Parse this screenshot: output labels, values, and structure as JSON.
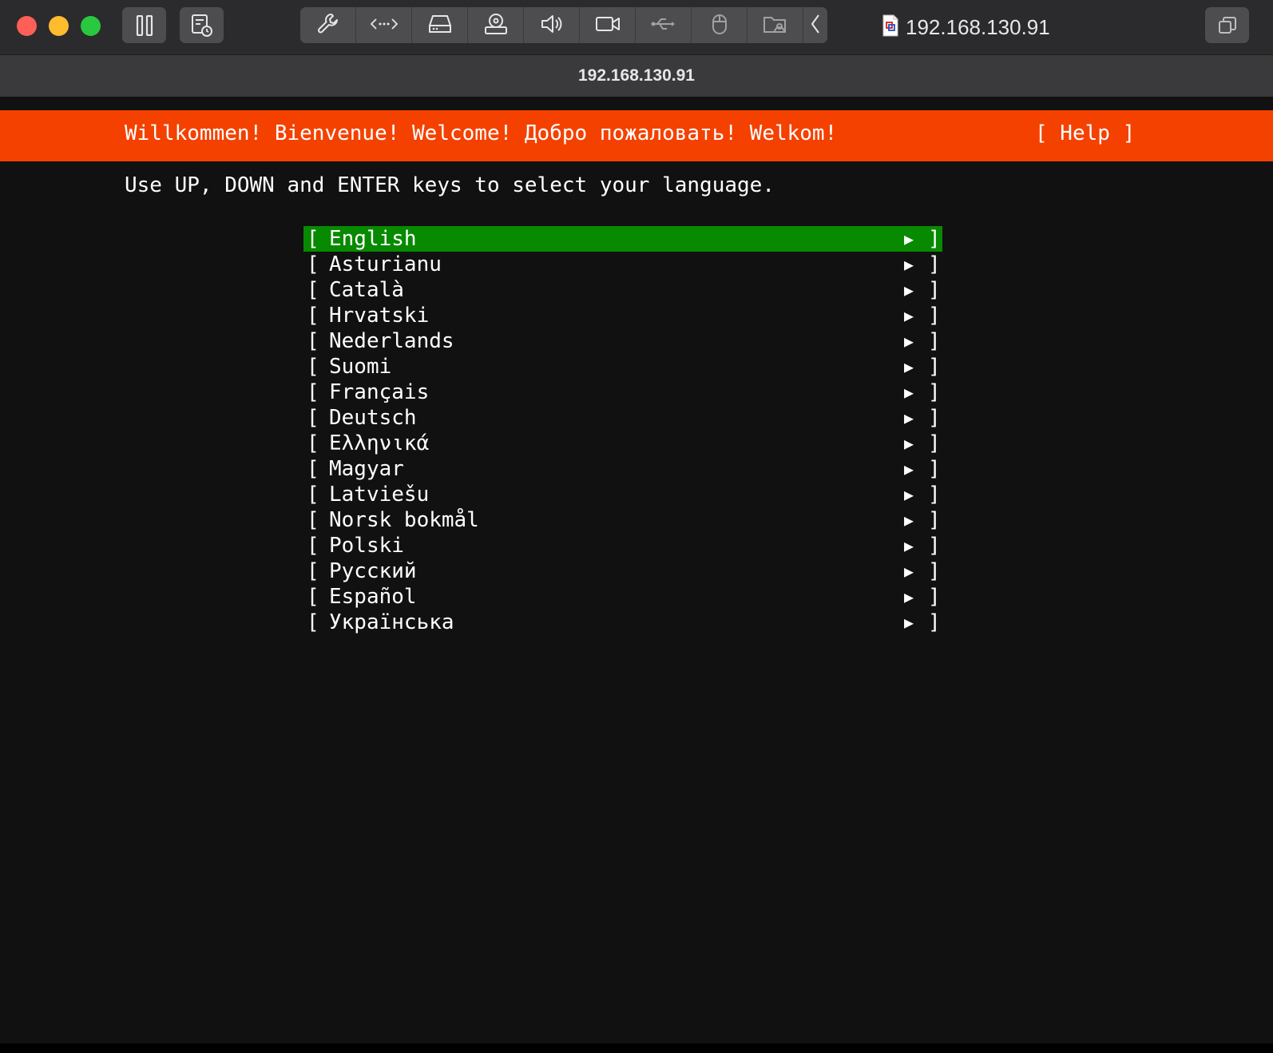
{
  "window": {
    "title": "192.168.130.91",
    "address": "192.168.130.91"
  },
  "toolbar": {
    "icons": [
      "pause-icon",
      "snapshot-icon",
      "wrench-icon",
      "network-icon",
      "harddisk-icon",
      "optical-drive-icon",
      "sound-icon",
      "camera-icon",
      "usb-icon",
      "mouse-icon",
      "shared-folder-icon",
      "chevron-left-icon",
      "restore-window-icon"
    ]
  },
  "installer": {
    "banner_text": "Willkommen! Bienvenue! Welcome! Добро пожаловать! Welkom!",
    "help_label": "[ Help ]",
    "instruction": "Use UP, DOWN and ENTER keys to select your language.",
    "bracket_open": "[",
    "bracket_close": "]",
    "arrow": "▶",
    "selected_index": 0,
    "languages": [
      "English",
      "Asturianu",
      "Català",
      "Hrvatski",
      "Nederlands",
      "Suomi",
      "Français",
      "Deutsch",
      "Ελληνικά",
      "Magyar",
      "Latviešu",
      "Norsk bokmål",
      "Polski",
      "Русский",
      "Español",
      "Українська"
    ]
  },
  "colors": {
    "banner": "#f44100",
    "selected": "#078a00",
    "background": "#111111"
  }
}
